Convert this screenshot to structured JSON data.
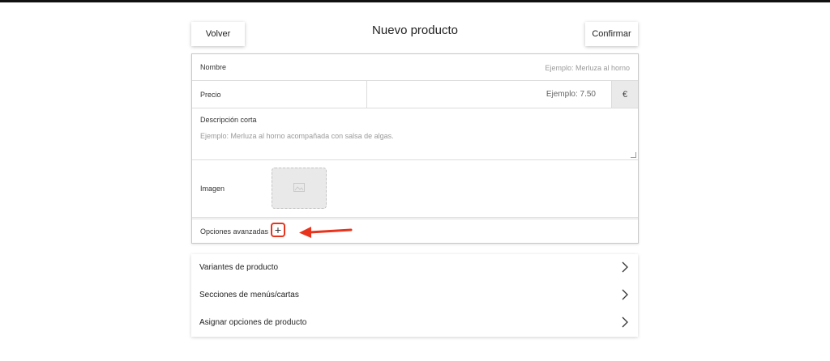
{
  "header": {
    "back_label": "Volver",
    "title": "Nuevo producto",
    "confirm_label": "Confirmar"
  },
  "form": {
    "nombre": {
      "label": "Nombre",
      "placeholder": "Ejemplo: Merluza al horno"
    },
    "precio": {
      "label": "Precio",
      "placeholder": "Ejemplo: 7.50",
      "currency": "€"
    },
    "descripcion": {
      "label": "Descripción corta",
      "placeholder": "Ejemplo: Merluza al horno acompañada con salsa de algas."
    },
    "imagen": {
      "label": "Imagen",
      "icon": "image-placeholder-icon"
    },
    "avanzadas": {
      "label": "Opciones avanzadas",
      "button": "+"
    }
  },
  "annotation": {
    "color": "#e8341c"
  },
  "list": {
    "items": [
      {
        "label": "Variantes de producto"
      },
      {
        "label": "Secciones de menús/cartas"
      },
      {
        "label": "Asignar opciones de producto"
      }
    ]
  }
}
